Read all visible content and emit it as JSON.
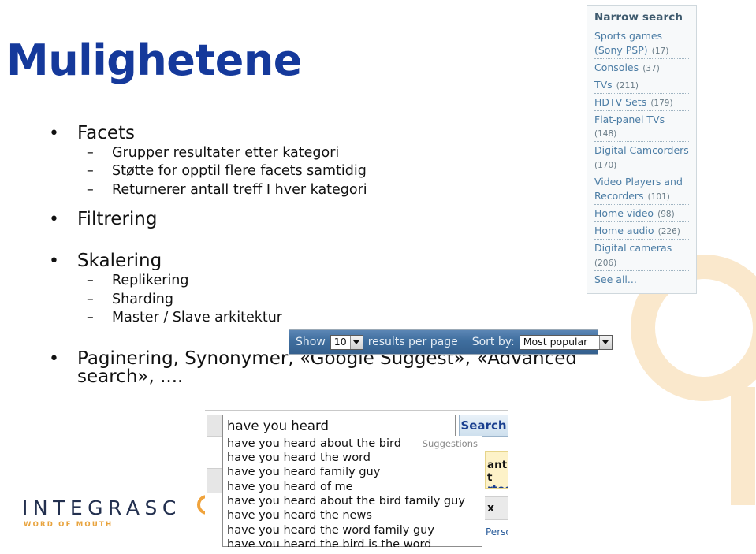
{
  "slide": {
    "title": "Mulighetene",
    "title_color": "#15399b",
    "bullets": [
      {
        "label": "Facets",
        "sub": [
          "Grupper resultater etter kategori",
          "Støtte for opptil flere facets samtidig",
          "Returnerer antall treff I hver kategori"
        ]
      },
      {
        "label": "Filtrering",
        "sub": []
      },
      {
        "label": "Skalering",
        "sub": [
          "Replikering",
          "Sharding",
          "Master / Slave arkitektur"
        ]
      },
      {
        "label": "Paginering, Synonymer, «Google Suggest», «Advanced search», ....",
        "sub": []
      }
    ],
    "bullet_marker": "•",
    "sub_marker": "–"
  },
  "facet_panel": {
    "title": "Narrow search",
    "link_color": "#4c7da5",
    "items": [
      {
        "label": "Sports games (Sony PSP)",
        "count": "(17)"
      },
      {
        "label": "Consoles",
        "count": "(37)"
      },
      {
        "label": "TVs",
        "count": "(211)"
      },
      {
        "label": "HDTV Sets",
        "count": "(179)"
      },
      {
        "label": "Flat-panel TVs",
        "count": "(148)"
      },
      {
        "label": "Digital Camcorders",
        "count": "(170)"
      },
      {
        "label": "Video Players and Recorders",
        "count": "(101)"
      },
      {
        "label": "Home video",
        "count": "(98)"
      },
      {
        "label": "Home audio",
        "count": "(226)"
      },
      {
        "label": "Digital cameras",
        "count": "(206)"
      },
      {
        "label": "See all...",
        "count": ""
      }
    ]
  },
  "results_toolbar": {
    "show_label": "Show",
    "per_page_value": "10",
    "per_page_suffix": "results per page",
    "sort_label": "Sort by:",
    "sort_value": "Most popular",
    "accent_color": "#3f6e9e"
  },
  "search_widget": {
    "query": "have you heard",
    "search_button": "Search",
    "suggestions_label": "Suggestions",
    "suggestions": [
      "have you heard about the bird",
      "have you heard the word",
      "have you heard family guy",
      "have you heard of me",
      "have you heard about the bird family guy",
      "have you heard the news",
      "have you heard the word family guy",
      "have you heard the bird is the word"
    ],
    "peek_yellow_line1": "ant t",
    "peek_yellow_line2": "rted",
    "peek_gray_text": "x",
    "peek_person_text": "Person"
  },
  "logo": {
    "wordmark": "INTEGRASC",
    "tagline": "WORD OF MOUTH",
    "accent_color": "#f0a33c"
  }
}
